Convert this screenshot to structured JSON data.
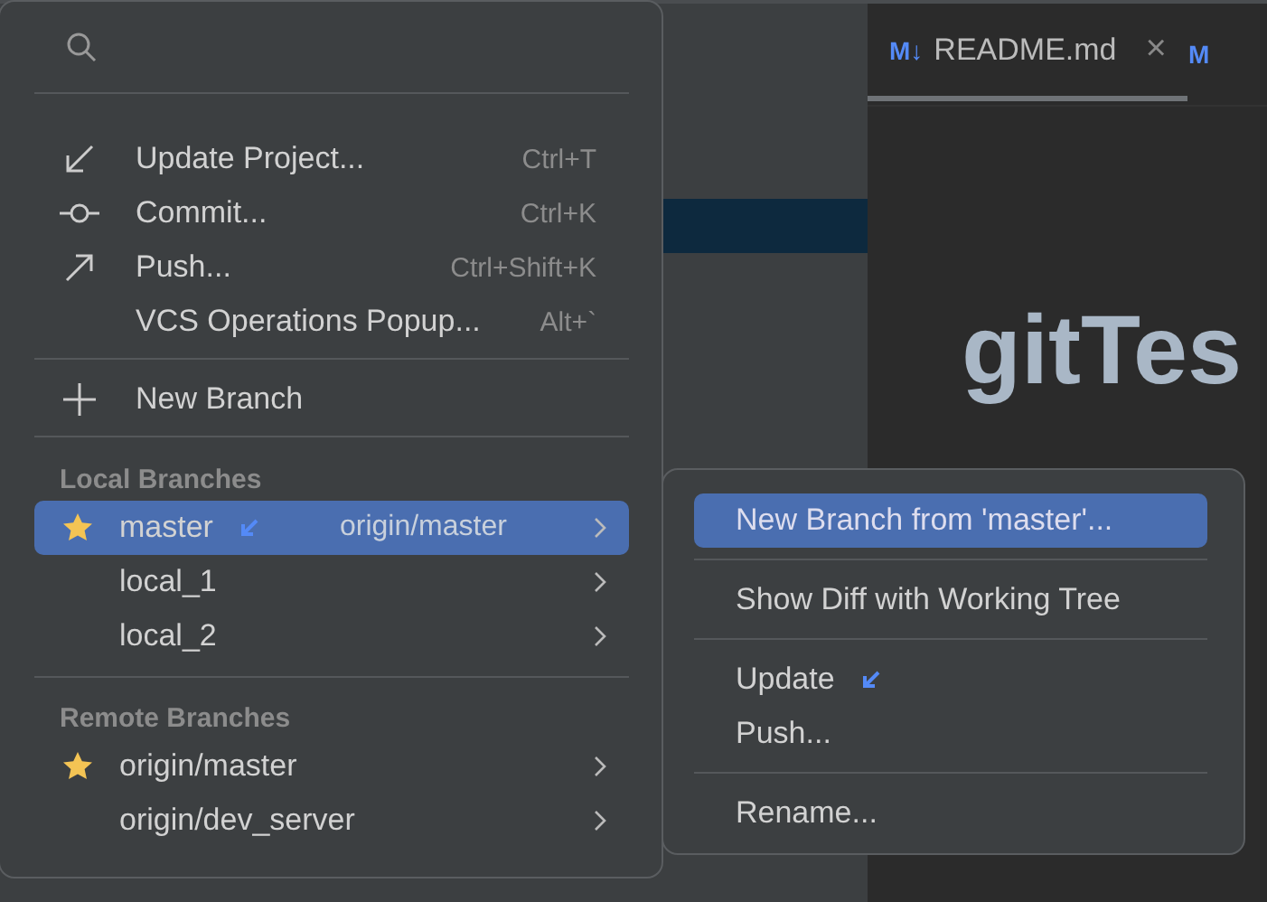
{
  "editor": {
    "tabs": [
      {
        "icon_text": "M↓",
        "label": "README.md",
        "close": "×",
        "selected": true
      }
    ],
    "next_tab_icon_text": "M",
    "heading": "gitTes"
  },
  "branches_popup": {
    "actions": [
      {
        "kind": "update",
        "label": "Update Project...",
        "shortcut": "Ctrl+T"
      },
      {
        "kind": "commit",
        "label": "Commit...",
        "shortcut": "Ctrl+K"
      },
      {
        "kind": "push",
        "label": "Push...",
        "shortcut": "Ctrl+Shift+K"
      },
      {
        "kind": "plain",
        "label": "VCS Operations Popup...",
        "shortcut": "Alt+`"
      }
    ],
    "new_branch": "New Branch",
    "sections": [
      {
        "title": "Local Branches",
        "branches": [
          {
            "name": "master",
            "favorite": true,
            "selected": true,
            "incoming": true,
            "tracking": "origin/master"
          },
          {
            "name": "local_1",
            "favorite": false,
            "selected": false,
            "incoming": false
          },
          {
            "name": "local_2",
            "favorite": false,
            "selected": false,
            "incoming": false
          }
        ]
      },
      {
        "title": "Remote Branches",
        "branches": [
          {
            "name": "origin/master",
            "favorite": true,
            "selected": false,
            "incoming": false
          },
          {
            "name": "origin/dev_server",
            "favorite": false,
            "selected": false,
            "incoming": false
          }
        ]
      }
    ]
  },
  "branch_submenu": {
    "groups": [
      [
        {
          "label": "New Branch from 'master'...",
          "selected": true,
          "incoming": false
        }
      ],
      [
        {
          "label": "Show Diff with Working Tree",
          "selected": false,
          "incoming": false
        }
      ],
      [
        {
          "label": "Update",
          "selected": false,
          "incoming": true
        },
        {
          "label": "Push...",
          "selected": false,
          "incoming": false
        }
      ],
      [
        {
          "label": "Rename...",
          "selected": false,
          "incoming": false
        }
      ]
    ]
  }
}
